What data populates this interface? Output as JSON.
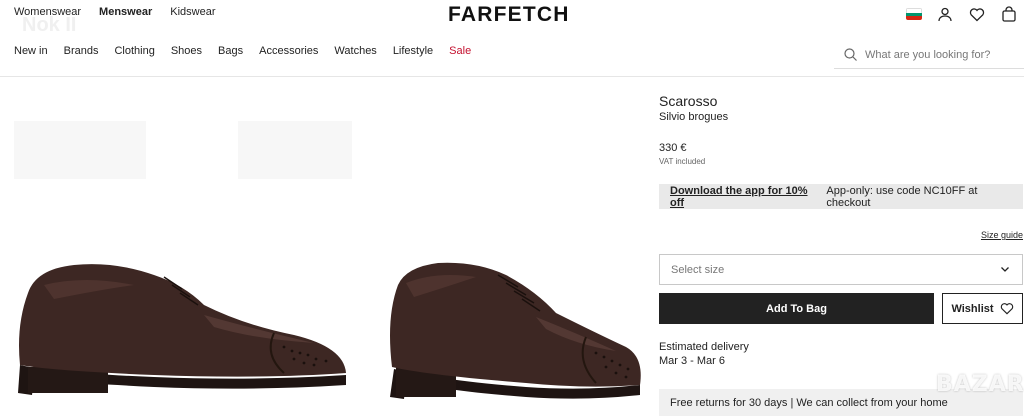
{
  "header": {
    "gender_nav": [
      "Womenswear",
      "Menswear",
      "Kidswear"
    ],
    "active_gender": "Menswear",
    "logo": "FARFETCH",
    "watermark": "Nok II",
    "icons": [
      "bulgaria-flag-icon",
      "user-icon",
      "heart-icon",
      "bag-icon"
    ],
    "flag_colors": [
      "#ffffff",
      "#00966e",
      "#d62612"
    ]
  },
  "nav": {
    "categories": [
      "New in",
      "Brands",
      "Clothing",
      "Shoes",
      "Bags",
      "Accessories",
      "Watches",
      "Lifestyle",
      "Sale"
    ],
    "sale_color": "#c4102f"
  },
  "search": {
    "placeholder": "What are you looking for?",
    "value": ""
  },
  "product": {
    "brand": "Scarosso",
    "name": "Silvio brogues",
    "price": "330 €",
    "vat": "VAT included",
    "promo_link": "Download the app for 10% off",
    "promo_text": "App-only: use code NC10FF at checkout",
    "size_guide": "Size guide",
    "select_size": "Select size",
    "add_to_bag": "Add To Bag",
    "wishlist": "Wishlist",
    "delivery_label": "Estimated delivery",
    "delivery_dates": "Mar 3 - Mar 6",
    "returns": "Free returns for 30 days | We can collect from your home"
  },
  "watermark_bottom": "BAZAR",
  "colors": {
    "shoe": "#3d2723",
    "button_dark": "#222222",
    "promo_bg": "#e9e9e9"
  }
}
